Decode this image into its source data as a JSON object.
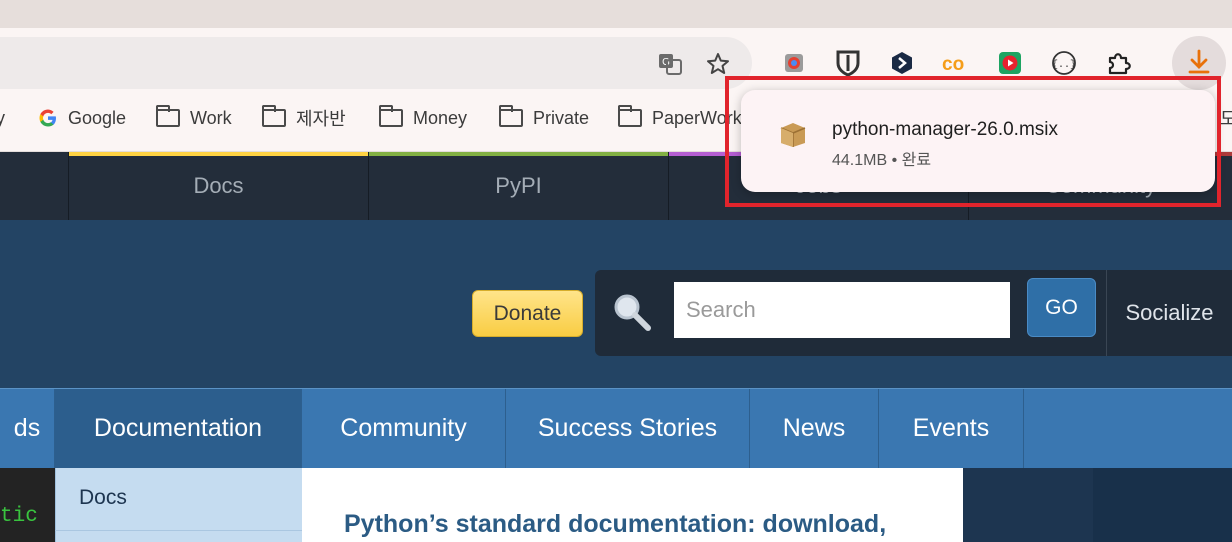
{
  "browser": {
    "bookmarks": [
      {
        "label": "ey",
        "type": "partial"
      },
      {
        "label": "Google",
        "type": "google"
      },
      {
        "label": "Work",
        "type": "folder"
      },
      {
        "label": "제자반",
        "type": "folder"
      },
      {
        "label": "Money",
        "type": "folder"
      },
      {
        "label": "Private",
        "type": "folder"
      },
      {
        "label": "PaperWork",
        "type": "folder"
      }
    ],
    "bookmark_overflow": "도",
    "extensions": [
      "extension-1-icon",
      "bitwarden-icon",
      "extension-hex-icon",
      "colab-icon",
      "video-extension-icon",
      "json-extension-icon",
      "puzzle-icon"
    ],
    "download_popup": {
      "filename": "python-manager-26.0.msix",
      "size": "44.1MB",
      "status": "완료",
      "separator": "•"
    }
  },
  "site": {
    "meta_nav": [
      {
        "label": "Docs",
        "color": "#ffd343"
      },
      {
        "label": "PyPI",
        "color": "#82b043"
      },
      {
        "label": "Jobs",
        "color": "#b55ed2"
      },
      {
        "label": "Community",
        "color": "#ad3b3b"
      }
    ],
    "donate_label": "Donate",
    "search_placeholder": "Search",
    "go_label": "GO",
    "socialize_label": "Socialize",
    "main_nav": [
      {
        "label": "ds",
        "active": false
      },
      {
        "label": "Documentation",
        "active": true
      },
      {
        "label": "Community",
        "active": false
      },
      {
        "label": "Success Stories",
        "active": false
      },
      {
        "label": "News",
        "active": false
      },
      {
        "label": "Events",
        "active": false
      }
    ],
    "code_fragment": "tic",
    "subnav_item": "Docs",
    "article_title": "Python’s standard documentation: download,"
  }
}
